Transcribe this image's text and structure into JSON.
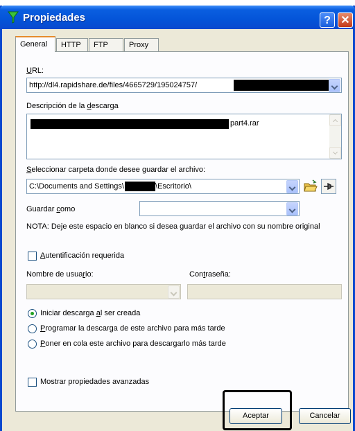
{
  "window": {
    "title": "Propiedades",
    "help_label": "?",
    "close_label": "✕"
  },
  "tabs": [
    {
      "label": "General",
      "active": true
    },
    {
      "label": "HTTP",
      "active": false
    },
    {
      "label": "FTP",
      "active": false
    },
    {
      "label": "Proxy",
      "active": false
    }
  ],
  "url": {
    "label_underlined": "U",
    "label_rest": "RL:",
    "value": "http://dl4.rapidshare.de/files/4665729/195024757/"
  },
  "description": {
    "label_pre": "Descripción de la ",
    "label_underlined": "d",
    "label_post": "escarga",
    "value_suffix": "part4.rar"
  },
  "folder": {
    "label_underlined": "S",
    "label_rest": "eleccionar carpeta donde desee guardar el archivo:",
    "value_prefix": "C:\\Documents and Settings\\",
    "value_suffix": "\\Escritorio\\"
  },
  "save_as": {
    "label_pre": "Guardar ",
    "label_underlined": "c",
    "label_post": "omo",
    "value": ""
  },
  "note": "NOTA: Deje este espacio en blanco si desea guardar el archivo con su nombre original",
  "auth": {
    "label_underlined": "A",
    "label_rest": "utentificación requerida",
    "checked": false
  },
  "username": {
    "label_pre": "Nombre de usua",
    "label_underlined": "r",
    "label_post": "io:"
  },
  "password": {
    "label_pre": "Con",
    "label_underlined": "t",
    "label_post": "raseña:"
  },
  "radios": [
    {
      "pre": "Iniciar descarga ",
      "u": "a",
      "post": "l ser creada",
      "selected": true
    },
    {
      "pre": "",
      "u": "P",
      "post": "rogramar la descarga de este archivo para más tarde",
      "selected": false
    },
    {
      "pre": "",
      "u": "P",
      "post": "oner en cola este archivo para descargarlo más tarde",
      "selected": false
    }
  ],
  "advanced": {
    "label": "Mostrar propiedades avanzadas",
    "checked": false
  },
  "buttons": {
    "ok": "Aceptar",
    "cancel": "Cancelar"
  },
  "colors": {
    "titlebar": "#0a5ee0",
    "radio_dot": "#21a121",
    "tab_accent": "#e68b2c"
  }
}
